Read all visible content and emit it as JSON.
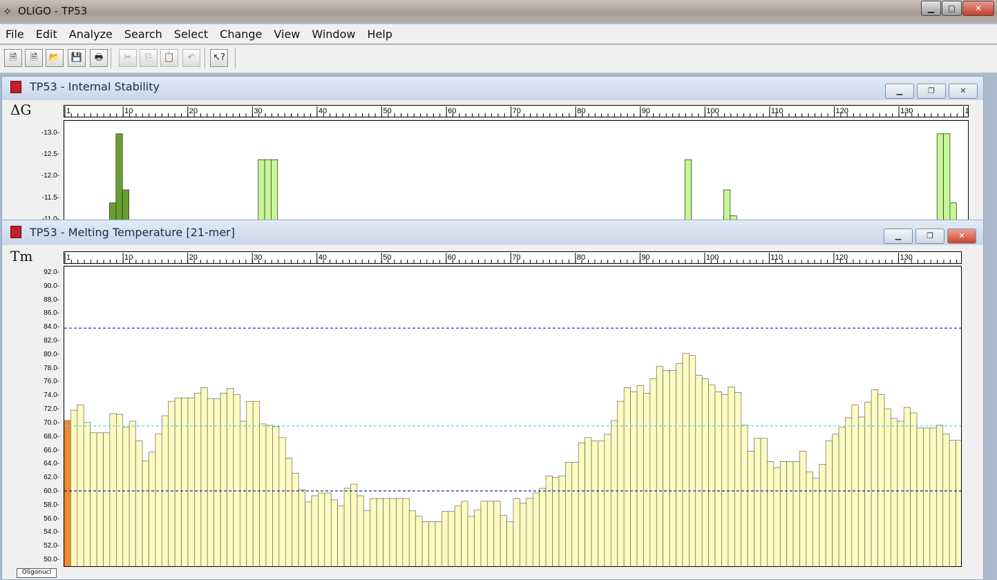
{
  "app": {
    "title": "OLIGO - TP53",
    "icon": "dna-app-icon"
  },
  "menu": [
    "File",
    "Edit",
    "Analyze",
    "Search",
    "Select",
    "Change",
    "View",
    "Window",
    "Help"
  ],
  "toolbar": {
    "buttons": [
      {
        "name": "new-sense-icon",
        "glyph": "🗎",
        "disabled": false
      },
      {
        "name": "new-dna-icon",
        "glyph": "🗎",
        "disabled": false
      },
      {
        "name": "open-folder-icon",
        "glyph": "📂",
        "disabled": false
      },
      {
        "name": "save-disk-icon",
        "glyph": "💾",
        "disabled": false
      },
      {
        "name": "print-icon",
        "glyph": "🖶",
        "disabled": false
      },
      {
        "name": "cut-icon",
        "glyph": "✂",
        "disabled": true
      },
      {
        "name": "copy-icon",
        "glyph": "⎘",
        "disabled": true
      },
      {
        "name": "paste-icon",
        "glyph": "📋",
        "disabled": true
      },
      {
        "name": "undo-icon",
        "glyph": "↶",
        "disabled": true
      },
      {
        "name": "context-help-icon",
        "glyph": "↖?",
        "disabled": false
      }
    ]
  },
  "stability_window": {
    "title": "TP53 - Internal Stability",
    "symbol": "ΔG",
    "ruler_labels": [
      "1",
      "10",
      "20",
      "30",
      "40",
      "50",
      "60",
      "70",
      "80",
      "90",
      "100",
      "110",
      "120",
      "130",
      "1"
    ],
    "y_ticks": [
      "-13.0",
      "-12.5",
      "-12.0",
      "-11.5",
      "-11.0"
    ]
  },
  "tm_window": {
    "title": "TP53 - Melting Temperature [21-mer]",
    "symbol": "Tm",
    "ruler_labels": [
      "1",
      "10",
      "20",
      "30",
      "40",
      "50",
      "60",
      "70",
      "80",
      "90",
      "100",
      "110",
      "120",
      "130"
    ],
    "y_ticks": [
      "92.0",
      "90.0",
      "88.0",
      "86.0",
      "84.0",
      "82.0",
      "80.0",
      "78.0",
      "76.0",
      "74.0",
      "72.0",
      "70.0",
      "68.0",
      "66.0",
      "64.0",
      "62.0",
      "60.0",
      "58.0",
      "56.0",
      "54.0",
      "52.0",
      "50.0"
    ],
    "bottom_tab": "Oligonucl"
  },
  "chart_data": [
    {
      "type": "bar",
      "title": "TP53 - Internal Stability",
      "ylabel": "ΔG",
      "xlim": [
        1,
        140
      ],
      "ylim": [
        -10.9,
        -13.3
      ],
      "series": [
        {
          "color": "#6a9e35",
          "x": [
            8,
            9,
            10
          ],
          "values": [
            -11.4,
            -13.0,
            -11.7
          ]
        },
        {
          "color": "#c9f59a",
          "x": [
            31,
            32,
            33
          ],
          "values": [
            -12.4,
            -12.4,
            -12.4
          ]
        },
        {
          "color": "#c9f59a",
          "x": [
            97
          ],
          "values": [
            -12.4
          ]
        },
        {
          "color": "#c9f59a",
          "x": [
            103,
            104
          ],
          "values": [
            -11.7,
            -11.1
          ]
        },
        {
          "color": "#c9f59a",
          "x": [
            136,
            137,
            138
          ],
          "values": [
            -13.0,
            -13.0,
            -11.4
          ]
        }
      ]
    },
    {
      "type": "bar",
      "title": "TP53 - Melting Temperature [21-mer]",
      "ylabel": "Tm",
      "xlim": [
        1,
        139
      ],
      "ylim": [
        49.0,
        93.0
      ],
      "reference_lines": [
        {
          "value": 84.0,
          "color": "#1a1f8c",
          "style": "dashed"
        },
        {
          "value": 69.7,
          "color": "#5fd0e8",
          "style": "dashed"
        },
        {
          "value": 60.2,
          "color": "#1a1f8c",
          "style": "dashed"
        }
      ],
      "highlight": {
        "index": 0,
        "color": "#f08a2c"
      },
      "values": [
        70.5,
        72.0,
        72.8,
        70.2,
        68.7,
        68.7,
        68.7,
        71.5,
        71.4,
        69.5,
        70.4,
        67.5,
        64.6,
        65.9,
        68.5,
        71.2,
        73.3,
        73.8,
        73.8,
        73.8,
        74.5,
        75.3,
        73.7,
        73.7,
        74.5,
        75.2,
        74.3,
        70.4,
        73.3,
        73.3,
        70.0,
        69.8,
        69.6,
        68.0,
        65.0,
        62.8,
        60.4,
        58.6,
        59.5,
        59.9,
        59.9,
        58.9,
        58.0,
        60.6,
        61.2,
        59.5,
        57.3,
        59.1,
        59.1,
        59.1,
        59.1,
        59.1,
        59.1,
        57.3,
        56.5,
        55.7,
        55.7,
        55.7,
        57.2,
        57.2,
        58.0,
        58.7,
        56.5,
        57.4,
        58.7,
        58.7,
        58.7,
        56.6,
        55.7,
        59.1,
        58.4,
        59.1,
        59.9,
        60.6,
        62.4,
        62.2,
        62.4,
        64.4,
        64.4,
        67.2,
        68.0,
        67.5,
        67.5,
        68.5,
        70.5,
        73.3,
        75.3,
        74.7,
        75.6,
        74.5,
        76.6,
        78.4,
        77.8,
        77.8,
        78.8,
        80.3,
        80.0,
        77.1,
        76.6,
        75.7,
        74.7,
        74.3,
        75.4,
        74.6,
        69.8,
        66.0,
        67.9,
        67.9,
        64.5,
        63.6,
        64.5,
        64.5,
        64.5,
        66.0,
        63.0,
        62.1,
        64.1,
        67.5,
        68.5,
        69.5,
        70.9,
        72.8,
        71.0,
        73.2,
        75.0,
        74.3,
        72.2,
        70.8,
        70.4,
        72.4,
        71.6,
        69.4,
        69.4,
        69.4,
        69.8,
        68.5,
        67.6,
        67.6
      ]
    }
  ]
}
